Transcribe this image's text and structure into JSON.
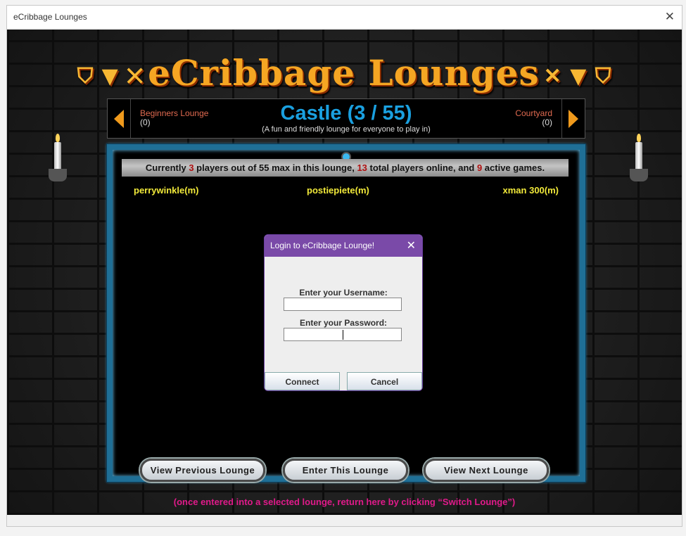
{
  "window": {
    "title": "eCribbage Lounges",
    "close": "✕"
  },
  "logo": {
    "text": "eCribbage Lounges"
  },
  "header": {
    "prev": {
      "name": "Beginners Lounge",
      "count": "(0)"
    },
    "title": "Castle (3 / 55)",
    "subtitle": "(A fun and friendly lounge for everyone to play in)",
    "next": {
      "name": "Courtyard",
      "count": "(0)"
    }
  },
  "status": {
    "p1": "Currently ",
    "players": "3",
    "p2": " players out of 55 max in this lounge, ",
    "online": "13",
    "p3": " total players online, and ",
    "games": "9",
    "p4": " active games."
  },
  "players": [
    "perrywinkle(m)",
    "postiepiete(m)",
    "xman 300(m)"
  ],
  "buttons": {
    "prev": "View Previous Lounge",
    "enter": "Enter This Lounge",
    "next": "View Next Lounge"
  },
  "note": "(once entered into a selected lounge, return here by clicking “Switch Lounge”)",
  "dialog": {
    "title": "Login to eCribbage Lounge!",
    "close": "✕",
    "username_label": "Enter your Username:",
    "username": "",
    "password_label": "Enter your Password:",
    "password": "",
    "connect": "Connect",
    "cancel": "Cancel"
  },
  "colors": {
    "title": "#1aa0e0",
    "player": "#f2ea3a",
    "note": "#e01a8a",
    "dialog_title": "#7a4aa8"
  }
}
